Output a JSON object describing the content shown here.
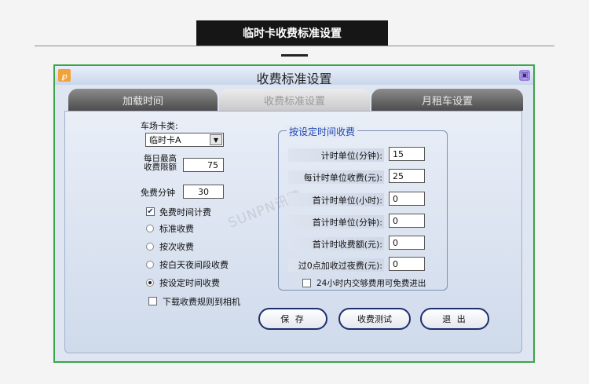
{
  "page": {
    "heading": "临时卡收费标准设置"
  },
  "window": {
    "title": "收费标准设置",
    "icon_glyph": "℘",
    "close_glyph": "▣"
  },
  "tabs": [
    {
      "label": "加载时间"
    },
    {
      "label": "收费标准设置"
    },
    {
      "label": "月租车设置"
    }
  ],
  "left": {
    "card_type_label": "车场卡类:",
    "card_type_value": "临时卡A",
    "daily_max_label_line1": "每日最高",
    "daily_max_label_line2": "收费限额",
    "daily_max_value": "75",
    "free_minutes_label": "免费分钟",
    "free_minutes_value": "30",
    "free_time_charge_label": "免费时间计费",
    "free_time_charge_checked": true,
    "options": [
      {
        "label": "标准收费",
        "selected": false
      },
      {
        "label": "按次收费",
        "selected": false
      },
      {
        "label": "按白天夜间段收费",
        "selected": false
      },
      {
        "label": "按设定时间收费",
        "selected": true
      }
    ],
    "download_label": "下载收费规则到相机",
    "download_checked": false
  },
  "group": {
    "title": "按设定时间收费",
    "fields": [
      {
        "label": "计时单位(分钟):",
        "value": "15"
      },
      {
        "label": "每计时单位收费(元):",
        "value": "25"
      },
      {
        "label": "首计时单位(小时):",
        "value": "0"
      },
      {
        "label": "首计时单位(分钟):",
        "value": "0"
      },
      {
        "label": "首计时收费额(元):",
        "value": "0"
      },
      {
        "label": "过0点加收过夜费(元):",
        "value": "0"
      }
    ],
    "free_exit_label": "24小时内交够费用可免费进出",
    "free_exit_checked": false
  },
  "watermark": "SUNPN讯鹏",
  "buttons": {
    "save": "保 存",
    "test": "收费测试",
    "exit": "退 出"
  },
  "colors": {
    "frame": "#3aa54a",
    "accent_blue": "#2146b0",
    "button_border": "#1c2f6e"
  }
}
